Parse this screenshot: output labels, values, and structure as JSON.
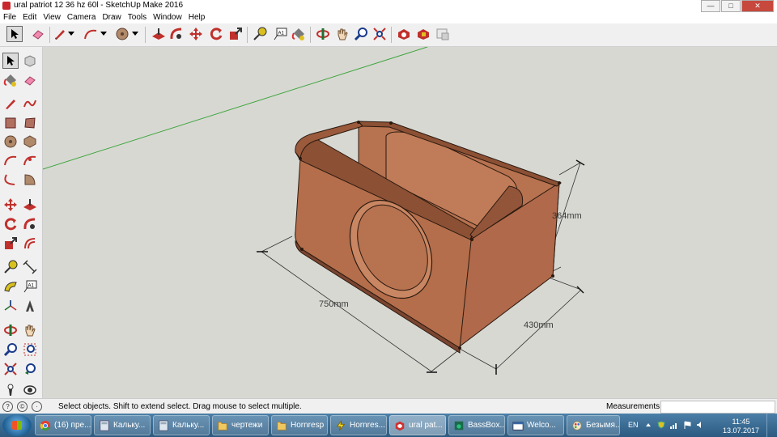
{
  "window": {
    "title": "ural patriot 12 36 hz 60l - SketchUp Make 2016"
  },
  "menu": [
    "File",
    "Edit",
    "View",
    "Camera",
    "Draw",
    "Tools",
    "Window",
    "Help"
  ],
  "toolbar_icons": [
    "select-tool",
    "eraser-tool",
    "pencil-tool",
    "arc-tool",
    "shapes-tool",
    "push-pull-tool",
    "follow-me-tool",
    "move-tool",
    "rotate-tool",
    "scale-tool",
    "tape-measure-tool",
    "text-tool",
    "paint-bucket-tool",
    "orbit-tool",
    "pan-tool",
    "zoom-tool",
    "zoom-extents-tool",
    "3d-warehouse",
    "extension-warehouse",
    "layout"
  ],
  "palette_icons": [
    "select-tool",
    "make-component-tool",
    "paint-bucket-tool",
    "eraser-tool",
    "line-tool",
    "freehand-tool",
    "rectangle-tool",
    "rotated-rectangle-tool",
    "circle-tool",
    "polygon-tool",
    "arc-tool",
    "two-point-arc-tool",
    "three-point-arc-tool",
    "pie-tool",
    "move-tool",
    "push-pull-tool",
    "rotate-tool",
    "follow-me-tool",
    "scale-tool",
    "offset-tool",
    "tape-measure-tool",
    "dimension-tool",
    "protractor-tool",
    "text-tool",
    "axes-tool",
    "3d-text-tool",
    "orbit-tool",
    "pan-tool",
    "zoom-tool",
    "zoom-window-tool",
    "zoom-extents-tool",
    "previous-view-tool",
    "position-camera-tool",
    "look-around-tool"
  ],
  "model": {
    "dimensions": {
      "length": "750mm",
      "depth": "430mm",
      "height": "364mm"
    },
    "wood_color": "#b06a45",
    "edge_color": "#2a1a10"
  },
  "status": {
    "text": "Select objects. Shift to extend select. Drag mouse to select multiple.",
    "measurements_label": "Measurements",
    "measurements_value": ""
  },
  "taskbar": {
    "tasks": [
      {
        "label": "(16) пре...",
        "icon": "chrome-icon"
      },
      {
        "label": "Кальку...",
        "icon": "calculator-icon"
      },
      {
        "label": "Кальку...",
        "icon": "calculator-icon"
      },
      {
        "label": "чертежи",
        "icon": "folder-icon"
      },
      {
        "label": "Hornresp",
        "icon": "folder-icon"
      },
      {
        "label": "Hornres...",
        "icon": "hornresp-icon"
      },
      {
        "label": "ural pat...",
        "icon": "sketchup-icon"
      },
      {
        "label": "BassBox...",
        "icon": "bassbox-icon"
      },
      {
        "label": "Welco...",
        "icon": "welcome-icon"
      },
      {
        "label": "Безымя...",
        "icon": "paint-icon"
      }
    ],
    "language": "EN",
    "time": "11:45",
    "date": "13.07.2017"
  }
}
